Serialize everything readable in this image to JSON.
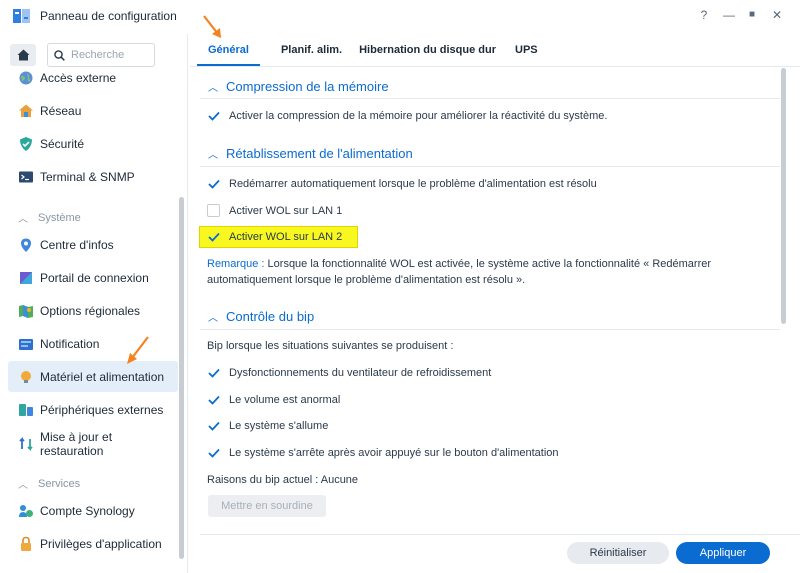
{
  "window": {
    "title": "Panneau de configuration",
    "controls": [
      "?",
      "—",
      "■",
      "✕"
    ]
  },
  "sidebar": {
    "search_placeholder": "Recherche",
    "items": [
      {
        "label": "Accès externe",
        "icon": "globe-icon"
      },
      {
        "label": "Réseau",
        "icon": "house-icon"
      },
      {
        "label": "Sécurité",
        "icon": "shield-icon"
      },
      {
        "label": "Terminal & SNMP",
        "icon": "terminal-icon"
      }
    ],
    "section_system": "Système",
    "system_items": [
      {
        "label": "Centre d'infos",
        "icon": "info-icon"
      },
      {
        "label": "Portail de connexion",
        "icon": "portal-icon"
      },
      {
        "label": "Options régionales",
        "icon": "map-icon"
      },
      {
        "label": "Notification",
        "icon": "notification-icon"
      },
      {
        "label": "Matériel et alimentation",
        "icon": "bulb-icon"
      },
      {
        "label": "Périphériques externes",
        "icon": "devices-icon"
      },
      {
        "label": "Mise à jour et",
        "label2": "restauration",
        "icon": "update-icon"
      }
    ],
    "section_services": "Services",
    "services_items": [
      {
        "label": "Compte Synology",
        "icon": "account-icon"
      },
      {
        "label": "Privilèges d'application",
        "icon": "lock-icon"
      }
    ]
  },
  "tabs": [
    "Général",
    "Planif. alim.",
    "Hibernation du disque dur",
    "UPS"
  ],
  "content": {
    "memory": {
      "title": "Compression de la mémoire",
      "option": "Activer la compression de la mémoire pour améliorer la réactivité du système."
    },
    "power": {
      "title": "Rétablissement de l'alimentation",
      "opt1": "Redémarrer automatiquement lorsque le problème d'alimentation est résolu",
      "opt2": "Activer WOL sur LAN 1",
      "opt3": "Activer WOL sur LAN 2",
      "remark_label": "Remarque :",
      "remark_text": " Lorsque la fonctionnalité WOL est activée, le système active la fonctionnalité « Redémarrer automatiquement lorsque le problème d'alimentation est résolu »."
    },
    "beep": {
      "title": "Contrôle du bip",
      "intro": "Bip lorsque les situations suivantes se produisent :",
      "opt1": "Dysfonctionnements du ventilateur de refroidissement",
      "opt2": "Le volume est anormal",
      "opt3": "Le système s'allume",
      "opt4": "Le système s'arrête après avoir appuyé sur le bouton d'alimentation",
      "reason": "Raisons du bip actuel : Aucune",
      "mute_btn": "Mettre en sourdine"
    }
  },
  "footer": {
    "reset": "Réinitialiser",
    "apply": "Appliquer"
  },
  "colors": {
    "accent": "#0a6bd1",
    "highlight": "#f8f820",
    "annotation_arrow": "#f5821f"
  }
}
